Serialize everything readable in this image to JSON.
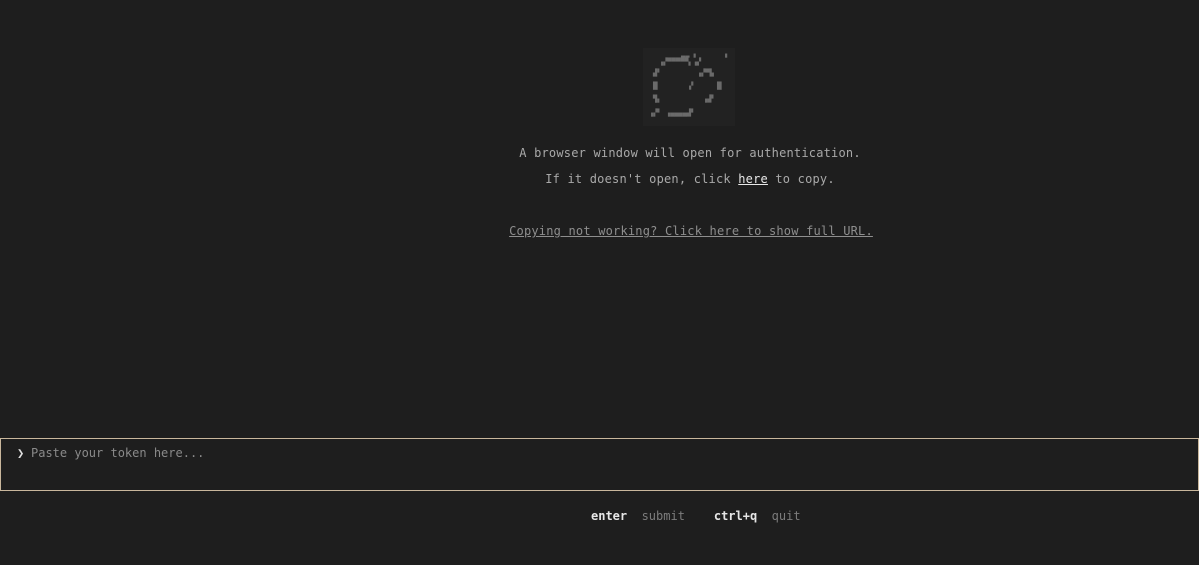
{
  "logo": {
    "icon": "ascii-art-logo-icon"
  },
  "message": {
    "line1": "A browser window will open for authentication.",
    "line2_prefix": "If it doesn't open, click ",
    "line2_link": "here",
    "line2_suffix": " to copy.",
    "fallback_link": "Copying not working? Click here to show full URL."
  },
  "token": {
    "prompt_glyph": "❯",
    "placeholder": "Paste your token here...",
    "value": ""
  },
  "footer": {
    "hints": [
      {
        "key": "enter",
        "action": "submit"
      },
      {
        "key": "ctrl+q",
        "action": "quit"
      }
    ]
  },
  "colors": {
    "background": "#1e1e1e",
    "input_border": "#c9b79c",
    "link": "#e8e8e8",
    "muted_text": "#a9a9a9"
  }
}
